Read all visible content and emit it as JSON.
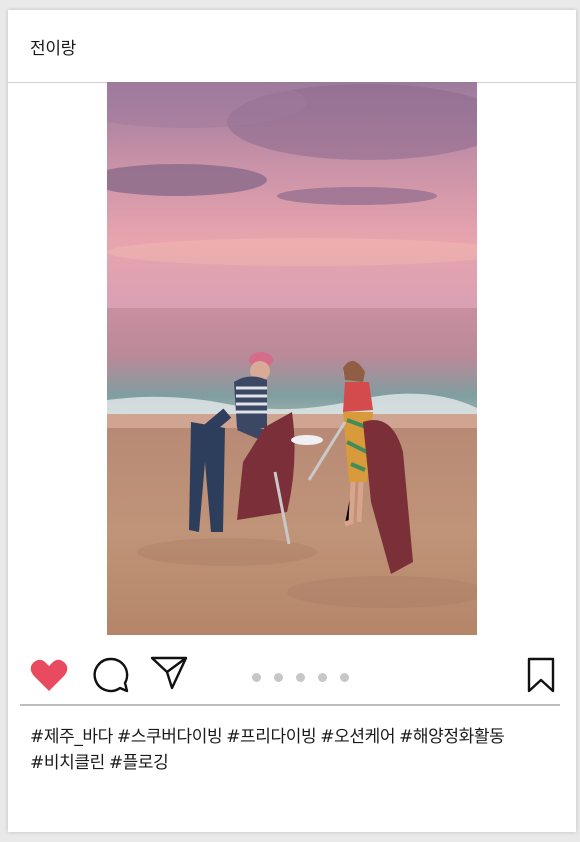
{
  "post": {
    "username": "전이랑",
    "image": {
      "subject": "beach cleanup at sunset photo"
    },
    "actions": {
      "like_icon": "heart-icon",
      "comment_icon": "comment-icon",
      "share_icon": "send-icon",
      "save_icon": "bookmark-icon",
      "like_color": "#e84a5f",
      "carousel_count": 5
    },
    "hashtags": [
      "#제주_바다",
      "#스쿠버다이빙",
      "#프리다이빙",
      "#오션케어",
      "#해양정화활동",
      "#비치클린",
      "#플로깅"
    ]
  }
}
